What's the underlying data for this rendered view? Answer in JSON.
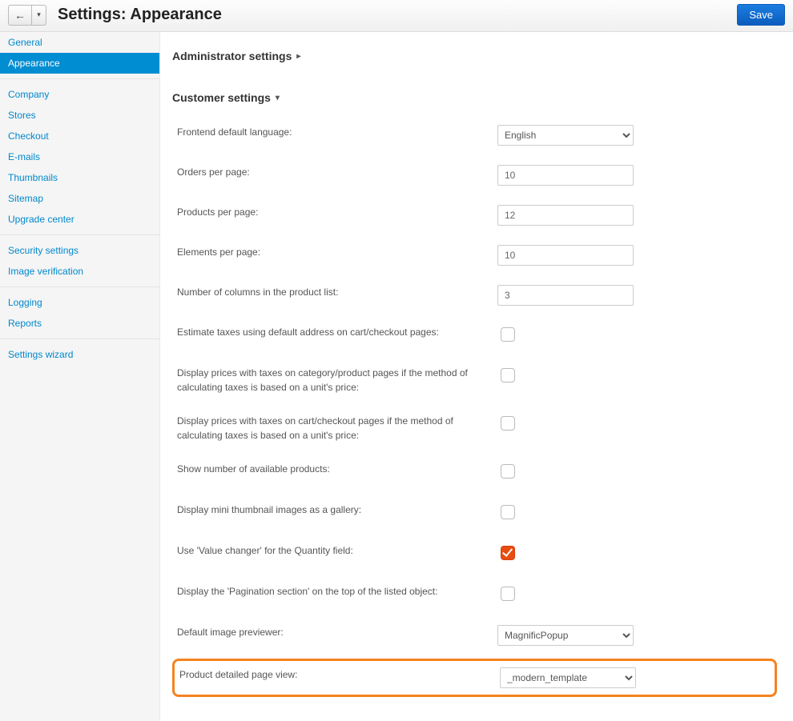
{
  "header": {
    "title": "Settings: Appearance",
    "save_label": "Save"
  },
  "sidebar": {
    "items": [
      {
        "label": "General",
        "active": false
      },
      {
        "label": "Appearance",
        "active": true
      },
      {
        "separator": true
      },
      {
        "label": "Company"
      },
      {
        "label": "Stores"
      },
      {
        "label": "Checkout"
      },
      {
        "label": "E-mails"
      },
      {
        "label": "Thumbnails"
      },
      {
        "label": "Sitemap"
      },
      {
        "label": "Upgrade center"
      },
      {
        "separator": true
      },
      {
        "label": "Security settings"
      },
      {
        "label": "Image verification"
      },
      {
        "separator": true
      },
      {
        "label": "Logging"
      },
      {
        "label": "Reports"
      },
      {
        "separator": true
      },
      {
        "label": "Settings wizard"
      }
    ]
  },
  "sections": {
    "admin_title": "Administrator settings",
    "customer_title": "Customer settings"
  },
  "form": {
    "frontend_lang": {
      "label": "Frontend default language:",
      "value": "English"
    },
    "orders_per_page": {
      "label": "Orders per page:",
      "value": "10"
    },
    "products_per_page": {
      "label": "Products per page:",
      "value": "12"
    },
    "elements_per_page": {
      "label": "Elements per page:",
      "value": "10"
    },
    "num_columns": {
      "label": "Number of columns in the product list:",
      "value": "3"
    },
    "estimate_taxes": {
      "label": "Estimate taxes using default address on cart/checkout pages:",
      "checked": false
    },
    "display_prices_category": {
      "label": "Display prices with taxes on category/product pages if the method of calculating taxes is based on a unit's price:",
      "checked": false
    },
    "display_prices_cart": {
      "label": "Display prices with taxes on cart/checkout pages if the method of calculating taxes is based on a unit's price:",
      "checked": false
    },
    "show_available": {
      "label": "Show number of available products:",
      "checked": false
    },
    "mini_thumb_gallery": {
      "label": "Display mini thumbnail images as a gallery:",
      "checked": false
    },
    "value_changer": {
      "label": "Use 'Value changer' for the Quantity field:",
      "checked": true
    },
    "pagination_top": {
      "label": "Display the 'Pagination section' on the top of the listed object:",
      "checked": false
    },
    "image_previewer": {
      "label": "Default image previewer:",
      "value": "MagnificPopup"
    },
    "product_detail_view": {
      "label": "Product detailed page view:",
      "value": "_modern_template"
    }
  }
}
